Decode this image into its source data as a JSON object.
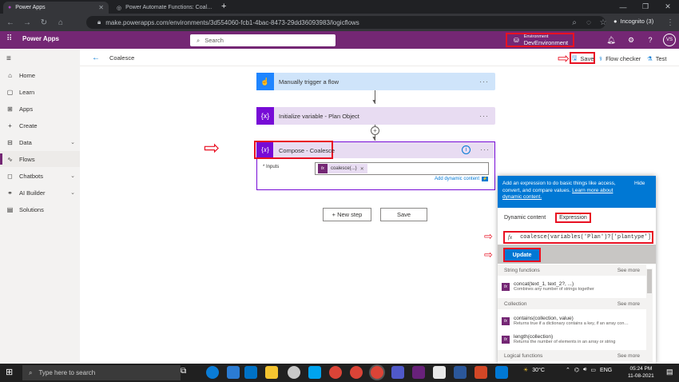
{
  "browser": {
    "tabs": [
      {
        "title": "Power Apps"
      },
      {
        "title": "Power Automate Functions: Coal…"
      }
    ],
    "new_tab": "+",
    "url": "make.powerapps.com/environments/3d554060-fcb1-4bac-8473-29dd36093983/logicflows",
    "profile_label": "Incognito (3)"
  },
  "header": {
    "app_name": "Power Apps",
    "search_placeholder": "Search",
    "environment_label": "Environment",
    "environment_value": "DevEnvironment",
    "avatar_initials": "VS"
  },
  "sidebar": {
    "items": [
      {
        "label": "Home"
      },
      {
        "label": "Learn"
      },
      {
        "label": "Apps"
      },
      {
        "label": "Create"
      },
      {
        "label": "Data"
      },
      {
        "label": "Flows"
      },
      {
        "label": "Chatbots"
      },
      {
        "label": "AI Builder"
      },
      {
        "label": "Solutions"
      }
    ]
  },
  "command_bar": {
    "flow_name": "Coalesce",
    "save_label": "Save",
    "flow_checker_label": "Flow checker",
    "test_label": "Test"
  },
  "flow": {
    "step1": "Manually trigger a flow",
    "step2": "Initialize variable - Plan Object",
    "step3": "Compose - Coalesce",
    "inputs_label": "* Inputs",
    "token_label": "coalesce(...)",
    "add_dynamic_label": "Add dynamic content",
    "new_step_label": "+ New step",
    "save_button_label": "Save"
  },
  "expression_panel": {
    "header_text": "Add an expression to do basic things like access, convert, and compare values.",
    "learn_more": "Learn more about dynamic content.",
    "hide_label": "Hide",
    "tab_dynamic": "Dynamic content",
    "tab_expression": "Expression",
    "expression_value": "coalesce(variables('Plan')?['plantype'],fa",
    "update_label": "Update",
    "sections": [
      {
        "title": "String functions",
        "more": "See more"
      },
      {
        "title": "Collection",
        "more": "See more"
      },
      {
        "title": "Logical functions",
        "more": "See more"
      }
    ],
    "functions": [
      {
        "name": "concat(text_1, text_2?, ...)",
        "desc": "Combines any number of strings together"
      },
      {
        "name": "contains(collection, value)",
        "desc": "Returns true if a dictionary contains a key, if an array con…"
      },
      {
        "name": "length(collection)",
        "desc": "Returns the number of elements in an array or string"
      }
    ]
  },
  "taskbar": {
    "search_placeholder": "Type here to search",
    "weather": "30°C",
    "language": "ENG",
    "time": "05:24 PM",
    "date": "11-08-2021"
  }
}
